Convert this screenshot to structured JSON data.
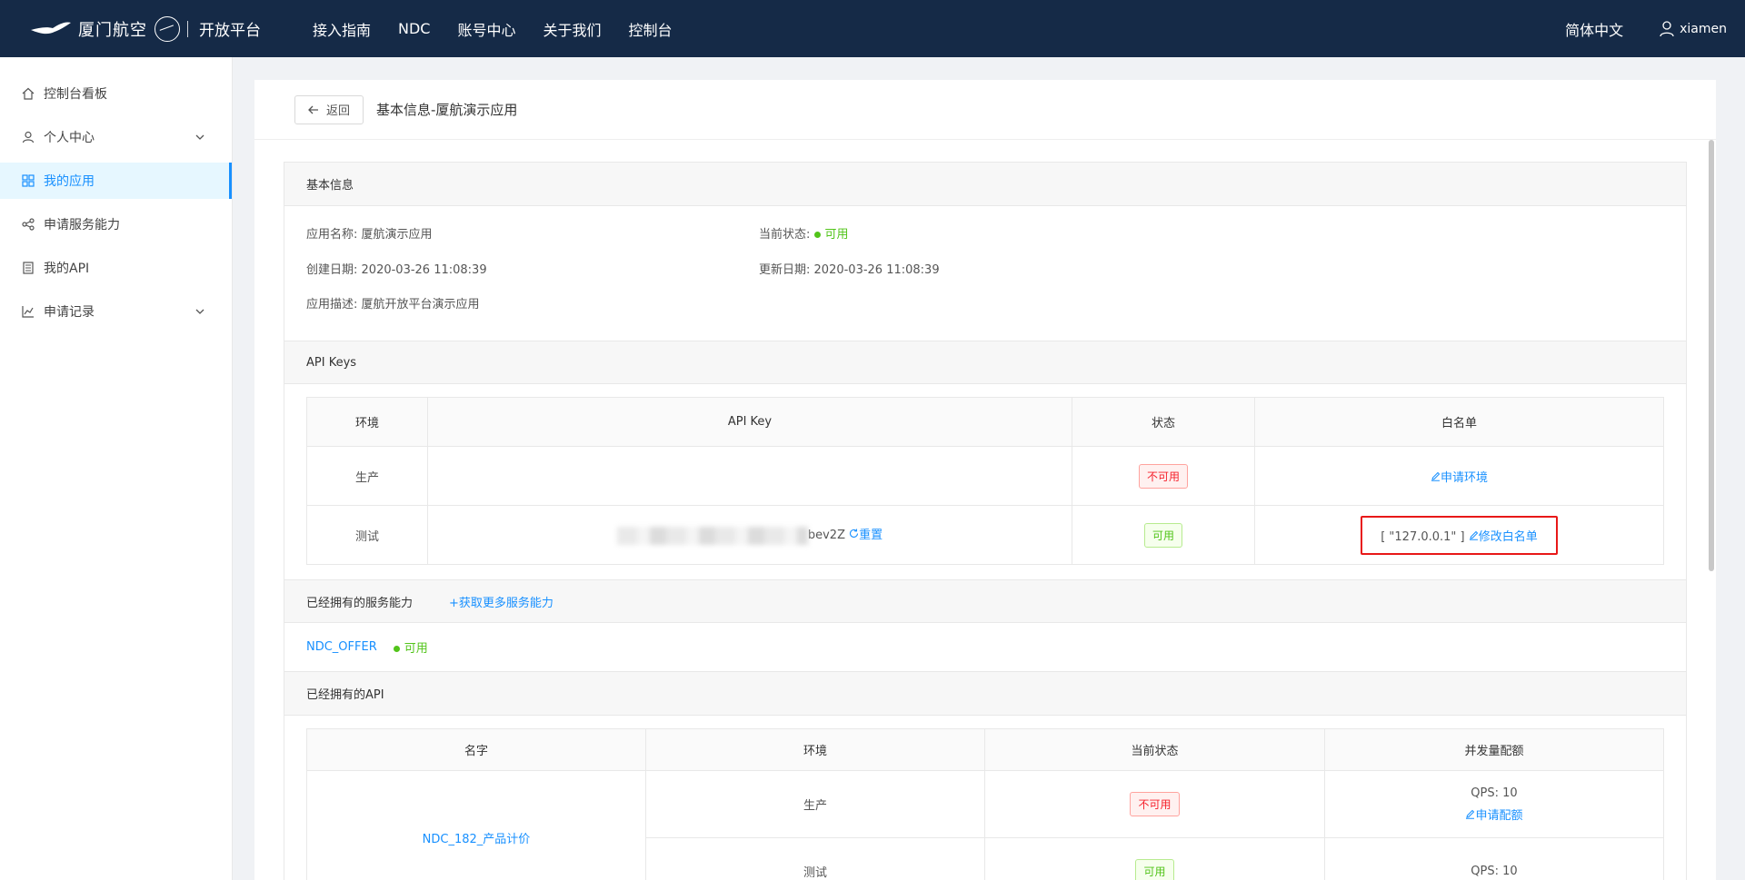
{
  "topnav": {
    "brand_name": "厦门航空",
    "platform": "开放平台",
    "items": [
      "接入指南",
      "NDC",
      "账号中心",
      "关于我们",
      "控制台"
    ],
    "lang": "简体中文",
    "username": "xiamen"
  },
  "sidebar": {
    "items": [
      {
        "label": "控制台看板",
        "icon": "home-icon"
      },
      {
        "label": "个人中心",
        "icon": "user-icon"
      },
      {
        "label": "我的应用",
        "icon": "apps-icon"
      },
      {
        "label": "申请服务能力",
        "icon": "share-icon"
      },
      {
        "label": "我的API",
        "icon": "doc-icon"
      },
      {
        "label": "申请记录",
        "icon": "chart-icon"
      }
    ]
  },
  "header": {
    "back_label": "返回",
    "title": "基本信息-厦航演示应用"
  },
  "basic": {
    "section_title": "基本信息",
    "name_label": "应用名称:",
    "name_value": "厦航演示应用",
    "status_label": "当前状态:",
    "status_value": "可用",
    "created_label": "创建日期:",
    "created_value": "2020-03-26 11:08:39",
    "updated_label": "更新日期:",
    "updated_value": "2020-03-26 11:08:39",
    "desc_label": "应用描述:",
    "desc_value": "厦航开放平台演示应用"
  },
  "api_keys": {
    "section_title": "API Keys",
    "columns": [
      "环境",
      "API Key",
      "状态",
      "白名单"
    ],
    "rows": [
      {
        "env": "生产",
        "key": "",
        "status": "不可用",
        "action": "申请环境"
      },
      {
        "env": "测试",
        "key_suffix": "bev2Z",
        "reset": "重置",
        "status": "可用",
        "whitelist": "[ \"127.0.0.1\" ]",
        "action": "修改白名单"
      }
    ]
  },
  "services": {
    "section_title": "已经拥有的服务能力",
    "more_link": "获取更多服务能力",
    "item_name": "NDC_OFFER",
    "item_status": "可用"
  },
  "apis": {
    "section_title": "已经拥有的API",
    "columns": [
      "名字",
      "环境",
      "当前状态",
      "并发量配额"
    ],
    "api_name": "NDC_182_产品计价",
    "rows": [
      {
        "env": "生产",
        "status": "不可用",
        "qps": "QPS: 10",
        "action": "申请配额"
      },
      {
        "env": "测试",
        "status": "可用",
        "qps": "QPS: 10"
      }
    ]
  }
}
